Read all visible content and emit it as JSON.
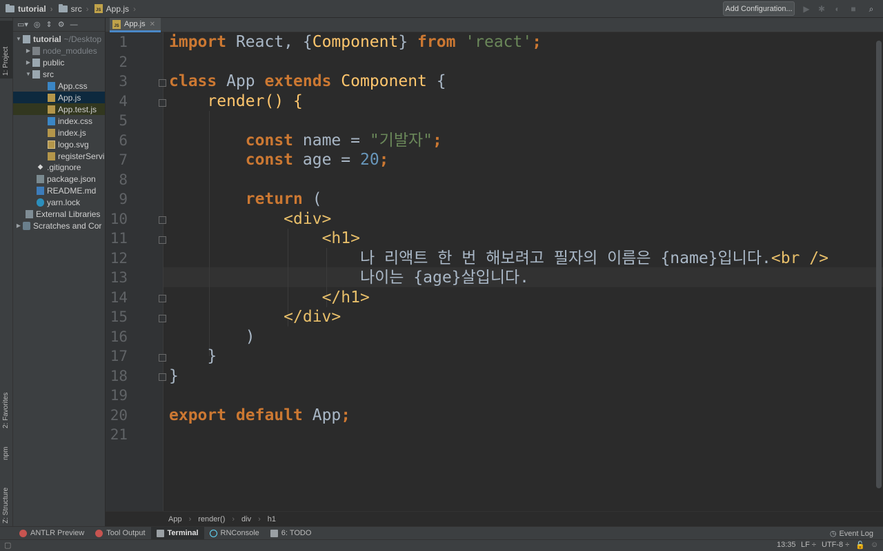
{
  "navbar": {
    "crumbs": [
      "tutorial",
      "src",
      "App.js"
    ],
    "add_config": "Add Configuration..."
  },
  "left_strip": {
    "project": "1: Project",
    "favorites": "2: Favorites",
    "npm": "npm",
    "structure": "Z: Structure"
  },
  "project_tree": {
    "root_name": "tutorial",
    "root_path": "~/Desktop",
    "items": [
      {
        "label": "node_modules"
      },
      {
        "label": "public"
      },
      {
        "label": "src"
      },
      {
        "label": "App.css"
      },
      {
        "label": "App.js"
      },
      {
        "label": "App.test.js"
      },
      {
        "label": "index.css"
      },
      {
        "label": "index.js"
      },
      {
        "label": "logo.svg"
      },
      {
        "label": "registerServi"
      },
      {
        "label": ".gitignore"
      },
      {
        "label": "package.json"
      },
      {
        "label": "README.md"
      },
      {
        "label": "yarn.lock"
      },
      {
        "label": "External Libraries"
      },
      {
        "label": "Scratches and Cor"
      }
    ]
  },
  "editor": {
    "tab_label": "App.js",
    "line_numbers": [
      "1",
      "2",
      "3",
      "4",
      "5",
      "6",
      "7",
      "8",
      "9",
      "10",
      "11",
      "12",
      "13",
      "14",
      "15",
      "16",
      "17",
      "18",
      "19",
      "20",
      "21"
    ],
    "code": {
      "l1_import": "import",
      "l1_a": " React, {",
      "l1_comp": "Component",
      "l1_b": "} ",
      "l1_from": "from",
      "l1_sp": " ",
      "l1_str": "'react'",
      "l1_semi": ";",
      "l3_class": "class",
      "l3_app": " App ",
      "l3_extends": "extends",
      "l3_comp": " Component",
      "l3_brace": " {",
      "l4": "    render() {",
      "l6_const": "const",
      "l6_name": " name = ",
      "l6_str": "\"기발자\"",
      "l6_semi": ";",
      "l7_const": "const",
      "l7_age": " age = ",
      "l7_num": "20",
      "l7_semi": ";",
      "l9_return": "return",
      "l9_paren": " (",
      "l10_tag": "<div>",
      "l11_tag": "<h1>",
      "l12_text": "나 리액트 한 번 해보려고 필자의 이름은 {name}입니다.",
      "l12_tag": "<br />",
      "l13_text": "나이는 {age}살입니다.",
      "l14_tag": "</h1>",
      "l15_tag": "</div>",
      "l16": ")",
      "l17": "}",
      "l18": "}",
      "l20_export": "export",
      "l20_sp": " ",
      "l20_default": "default",
      "l20_app": " App",
      "l20_semi": ";"
    }
  },
  "breadcrumb": [
    "App",
    "render()",
    "div",
    "h1"
  ],
  "bottom_tools": {
    "antlr": "ANTLR Preview",
    "tool_output": "Tool Output",
    "terminal": "Terminal",
    "rnconsole": "RNConsole",
    "todo": "6: TODO",
    "event_log": "Event Log"
  },
  "status": {
    "time": "13:35",
    "line_sep": "LF ÷",
    "encoding": "UTF-8 ÷"
  }
}
